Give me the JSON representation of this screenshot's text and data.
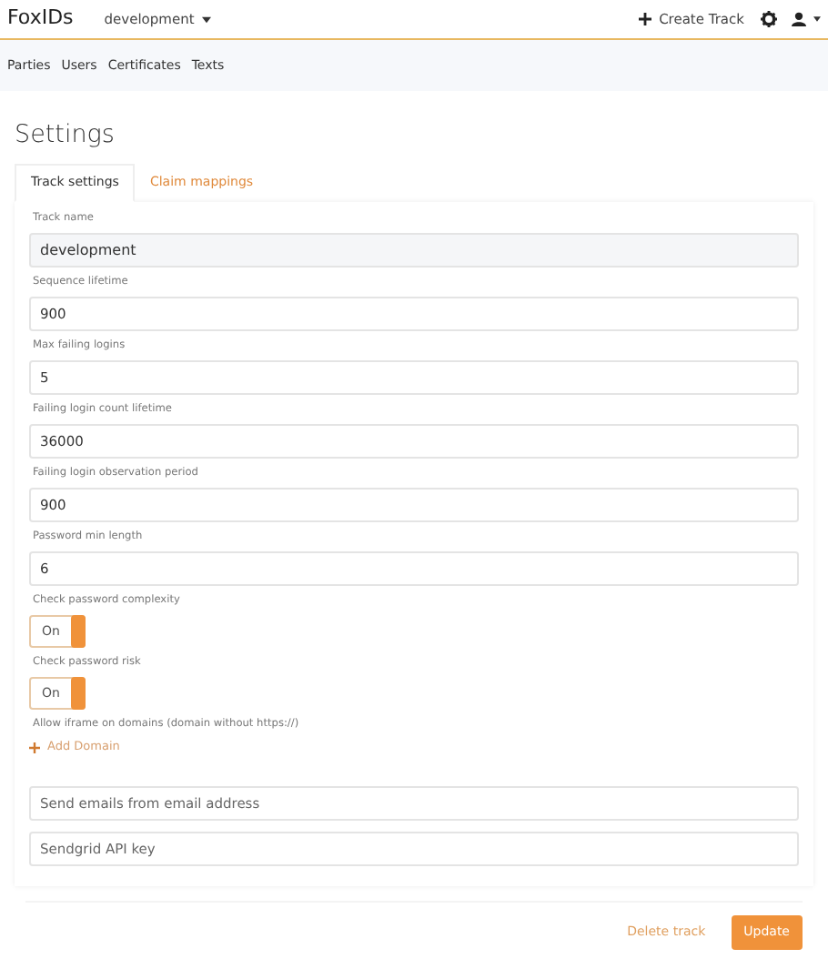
{
  "navbar": {
    "brand": "FoxIDs",
    "track_selector": "development",
    "create_track": "Create Track"
  },
  "subnav": {
    "items": [
      {
        "label": "Parties",
        "selected": false
      },
      {
        "label": "Users",
        "selected": false
      },
      {
        "label": "Certificates",
        "selected": false
      },
      {
        "label": "Texts",
        "selected": false
      }
    ]
  },
  "page_title": "Settings",
  "tabs": [
    {
      "label": "Track settings",
      "selected": true
    },
    {
      "label": "Claim mappings",
      "selected": false
    }
  ],
  "fields": [
    {
      "kind": "text",
      "label": "Track name",
      "value": "development",
      "readonly": true
    },
    {
      "kind": "text",
      "label": "Sequence lifetime",
      "value": "900",
      "readonly": false
    },
    {
      "kind": "text",
      "label": "Max failing logins",
      "value": "5",
      "readonly": false
    },
    {
      "kind": "text",
      "label": "Failing login count lifetime",
      "value": "36000",
      "readonly": false
    },
    {
      "kind": "text",
      "label": "Failing login observation period",
      "value": "900",
      "readonly": false
    },
    {
      "kind": "text",
      "label": "Password min length",
      "value": "6",
      "readonly": false
    },
    {
      "kind": "toggle",
      "label": "Check password complexity",
      "text": "On",
      "on": true
    },
    {
      "kind": "toggle",
      "label": "Check password risk",
      "text": "On",
      "on": true
    },
    {
      "kind": "list",
      "label": "Allow iframe on domains (domain without https://)",
      "add": "Add Domain"
    },
    {
      "kind": "placeholder",
      "placeholder": "Send emails from email address"
    },
    {
      "kind": "placeholder",
      "placeholder": "Sendgrid API key"
    }
  ],
  "buttons": {
    "delete": "Delete track",
    "update": "Update"
  }
}
